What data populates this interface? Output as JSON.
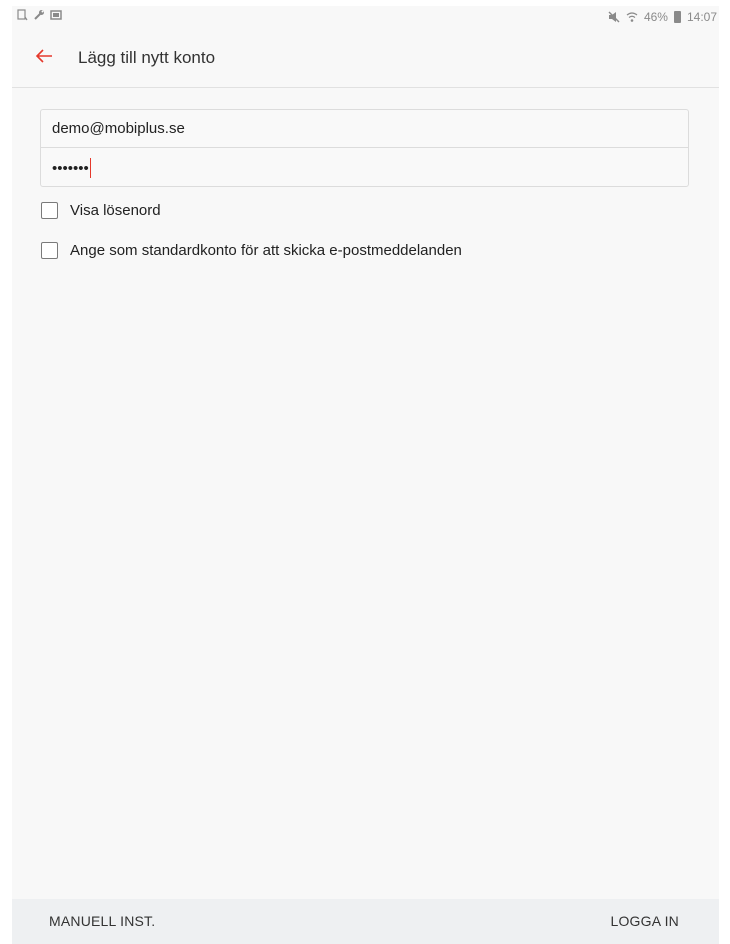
{
  "status_bar": {
    "left_icons": [
      "notification-icon",
      "wrench-icon",
      "image-icon"
    ],
    "right_icons": [
      "mute-icon",
      "wifi-icon",
      "battery-icon"
    ],
    "battery_text": "46%",
    "time": "14:07"
  },
  "app_bar": {
    "title": "Lägg till nytt konto",
    "back_icon": "back-arrow-icon",
    "accent_color": "#e5392c"
  },
  "form": {
    "email_value": "demo@mobiplus.se",
    "password_value": "•••••••",
    "show_password_label": "Visa lösenord",
    "show_password_checked": false,
    "default_account_label": "Ange som standardkonto för att skicka e-postmeddelanden",
    "default_account_checked": false
  },
  "bottom_bar": {
    "manual_label": "MANUELL INST.",
    "login_label": "LOGGA IN"
  }
}
